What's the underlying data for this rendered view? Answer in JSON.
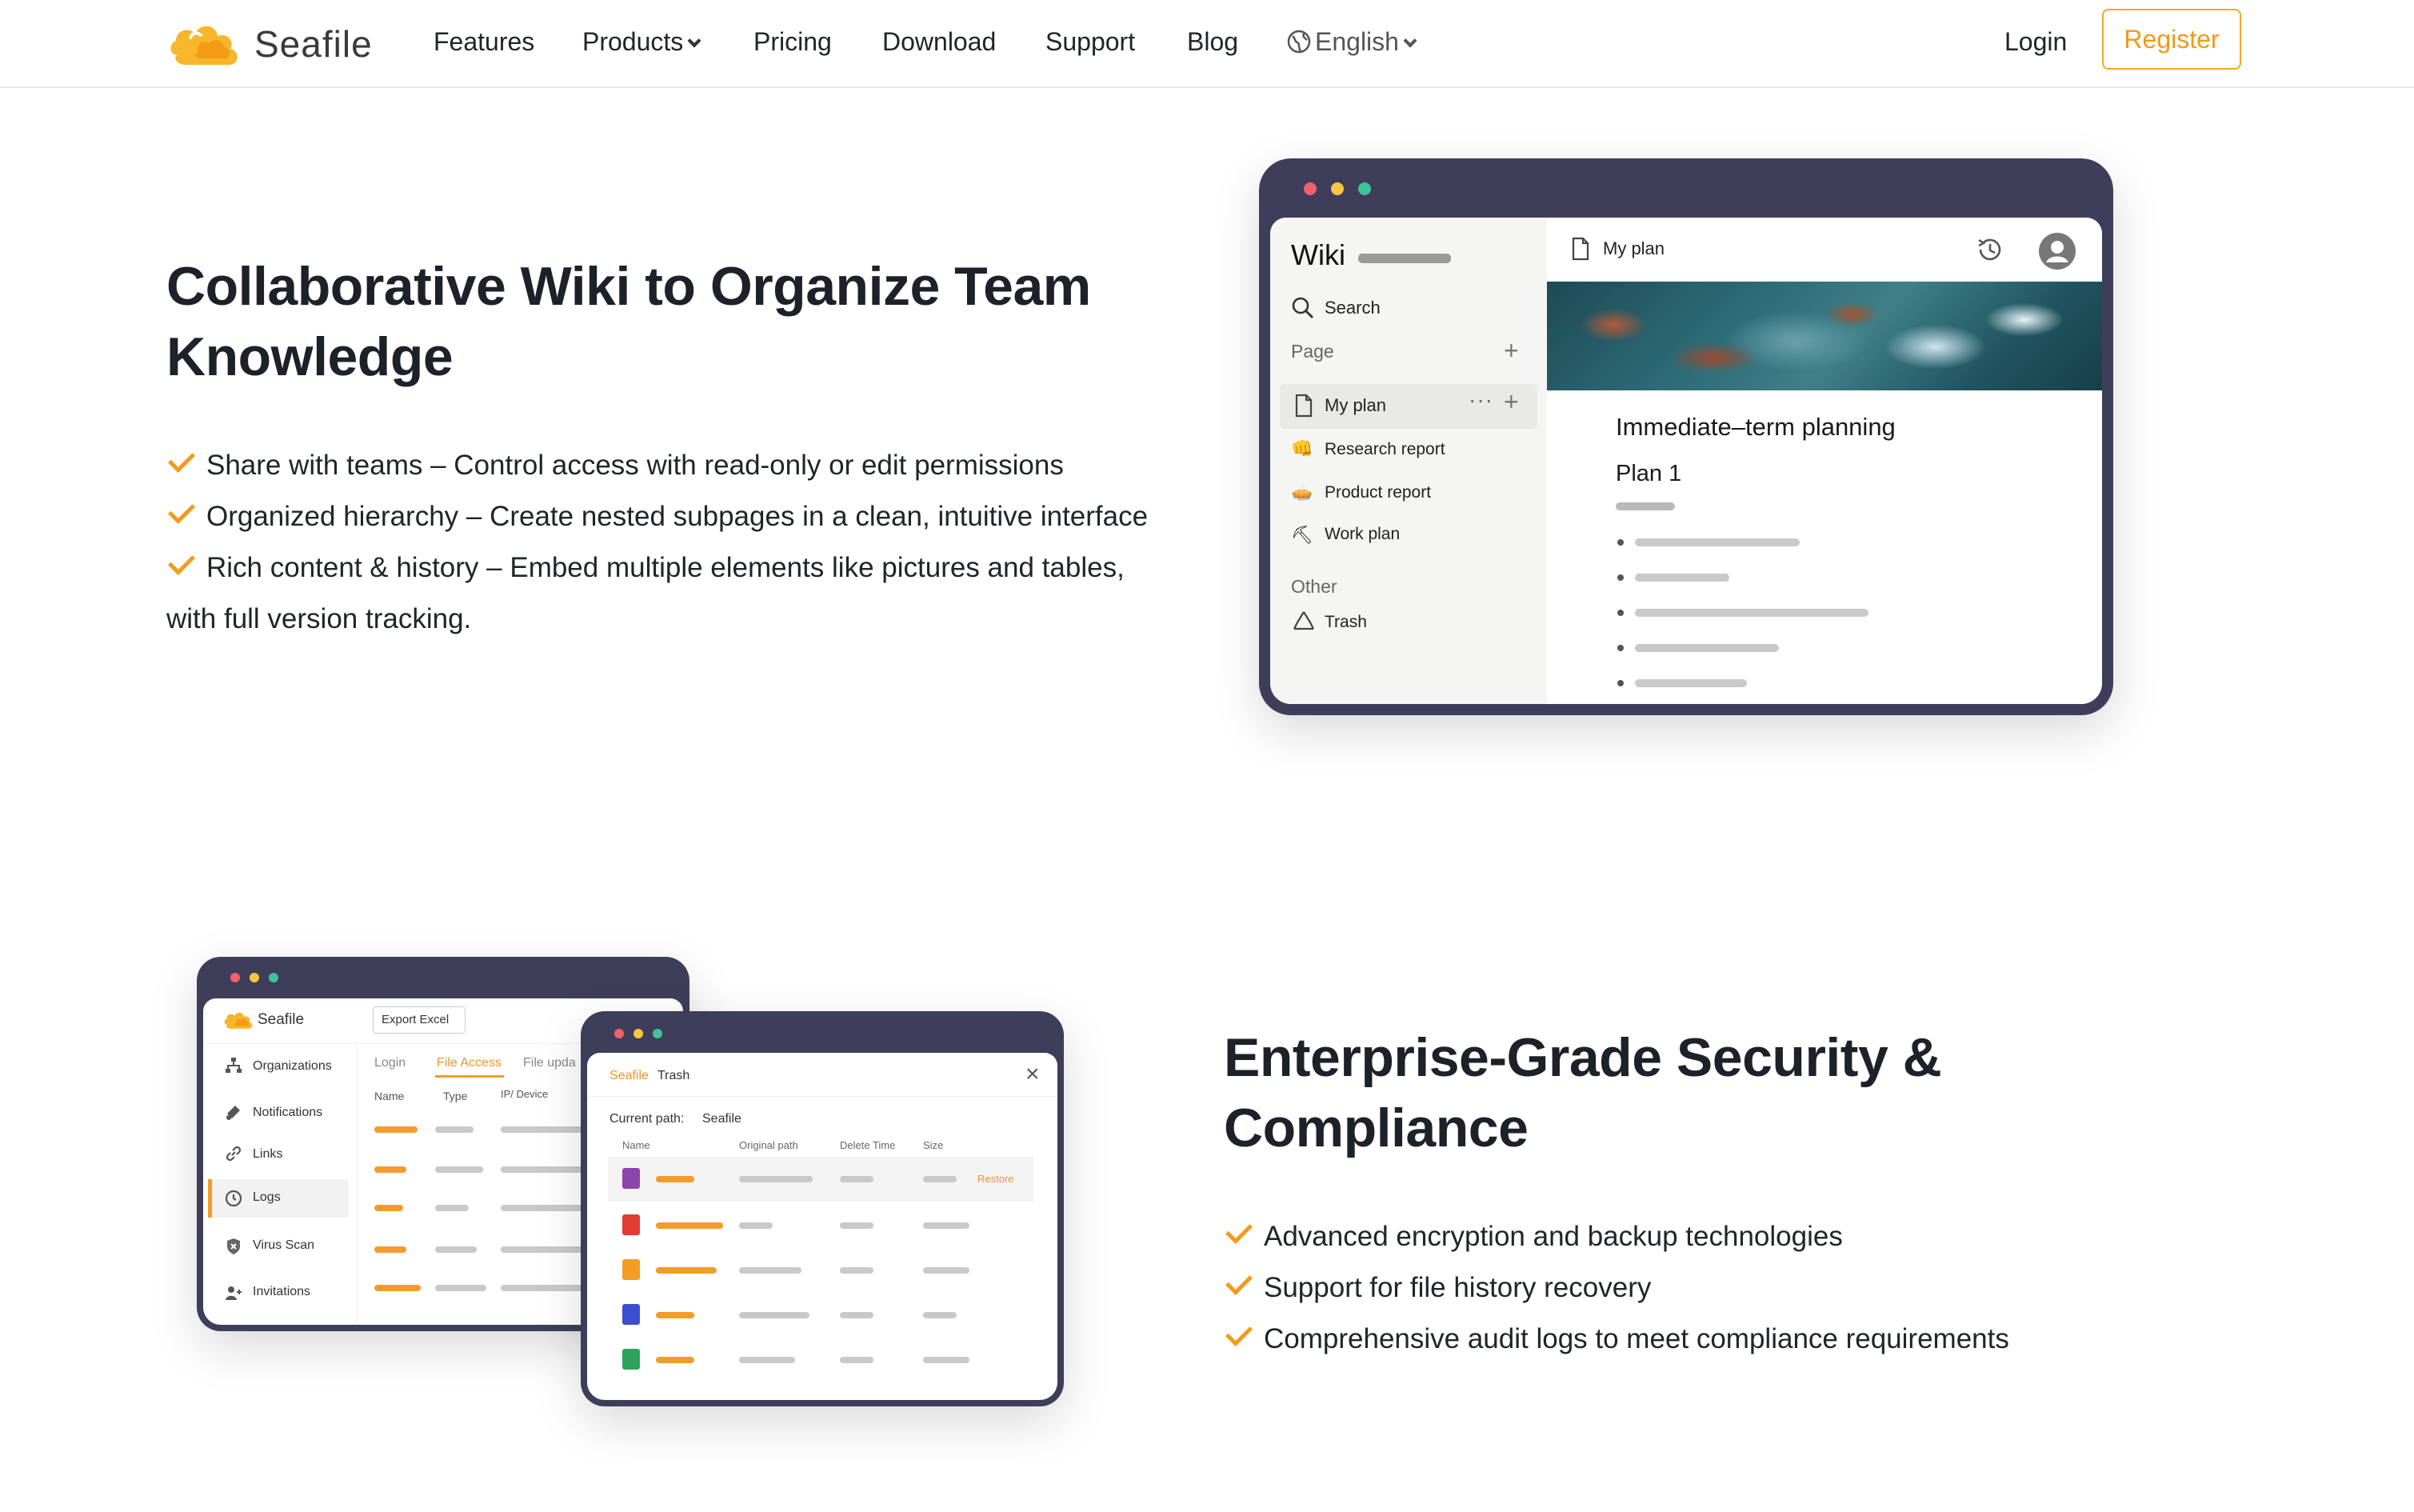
{
  "nav": {
    "logo_text": "Seafile",
    "items": [
      "Features",
      "Products",
      "Pricing",
      "Download",
      "Support",
      "Blog"
    ],
    "language": "English",
    "login": "Login",
    "register": "Register"
  },
  "wiki_section": {
    "title_line1": "Collaborative Wiki to Organize Team",
    "title_line2": "Knowledge",
    "features": [
      "Share with teams – Control access with read-only or edit permissions",
      "Organized hierarchy – Create nested subpages in a clean, intuitive interface",
      "Rich content & history – Embed multiple elements like pictures and tables,"
    ],
    "features_continuation": "with full version tracking.",
    "mockup": {
      "title": "Wiki",
      "search": "Search",
      "page_label": "Page",
      "pages": [
        "My plan",
        "Research report",
        "Product report",
        "Work plan"
      ],
      "page_icons": [
        "📄",
        "👊",
        "🥧",
        "⛏"
      ],
      "other_label": "Other",
      "trash": "Trash",
      "doc_title": "My plan",
      "heading": "Immediate–term planning",
      "subheading": "Plan 1"
    }
  },
  "security_section": {
    "title_line1": "Enterprise-Grade Security &",
    "title_line2": "Compliance",
    "features": [
      "Advanced encryption and backup technologies",
      "Support for file history recovery",
      "Comprehensive audit logs to meet compliance requirements"
    ],
    "admin_mockup": {
      "logo_text": "Seafile",
      "export_button": "Export Excel",
      "tabs": [
        "Login",
        "File Access",
        "File upda"
      ],
      "columns": [
        "Name",
        "Type",
        "IP/ Device"
      ],
      "sidebar": [
        "Organizations",
        "Notifications",
        "Links",
        "Logs",
        "Virus Scan",
        "Invitations"
      ]
    },
    "trash_mockup": {
      "brand": "Seafile",
      "title": "Trash",
      "current_path_label": "Current path:",
      "current_path_value": "Seafile",
      "columns": [
        "Name",
        "Original path",
        "Delete Time",
        "Size"
      ],
      "restore": "Restore"
    }
  },
  "colors": {
    "accent": "#f49b1a",
    "window_frame": "#3e3e5b",
    "dot_red": "#f0626a",
    "dot_yellow": "#f7c744",
    "dot_green": "#3fc49a"
  }
}
